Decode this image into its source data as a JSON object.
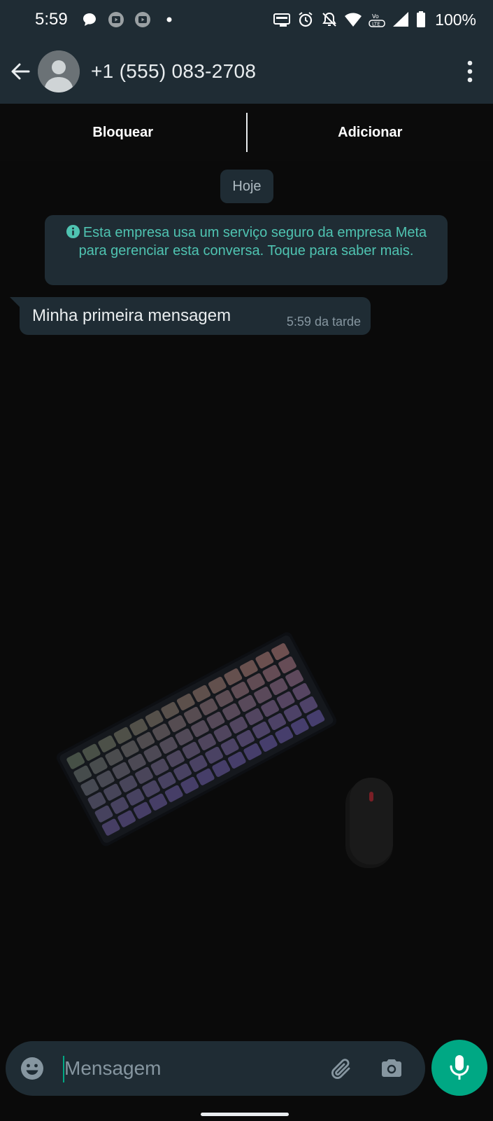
{
  "status_bar": {
    "time": "5:59",
    "battery": "100%",
    "left_icons": [
      "chat-bubble-icon",
      "youtube-icon",
      "youtube-icon",
      "dot-icon"
    ],
    "right_icons": [
      "hd-auto-icon",
      "alarm-icon",
      "bell-off-icon",
      "wifi-icon",
      "volte-lte-icon",
      "signal-icon",
      "battery-icon"
    ]
  },
  "header": {
    "contact_name": "+1 (555) 083-2708",
    "back_icon": "arrow-left-icon",
    "menu_icon": "more-vert-icon"
  },
  "actions": {
    "block_label": "Bloquear",
    "add_label": "Adicionar"
  },
  "chat": {
    "date_chip": "Hoje",
    "system_notice": "Esta empresa usa um serviço seguro da empresa Meta para gerenciar esta conversa. Toque para saber mais.",
    "messages": [
      {
        "text": "Minha primeira mensagem",
        "time": "5:59 da tarde",
        "direction": "incoming"
      }
    ]
  },
  "composer": {
    "placeholder": "Mensagem",
    "emoji_icon": "emoji-icon",
    "attach_icon": "paperclip-icon",
    "camera_icon": "camera-icon",
    "mic_icon": "microphone-icon"
  },
  "colors": {
    "header_bg": "#1f2c34",
    "chat_bg": "#0a0a0a",
    "bubble_bg": "#1f2c34",
    "accent": "#00a884",
    "notice_text": "#4fc3b1"
  }
}
